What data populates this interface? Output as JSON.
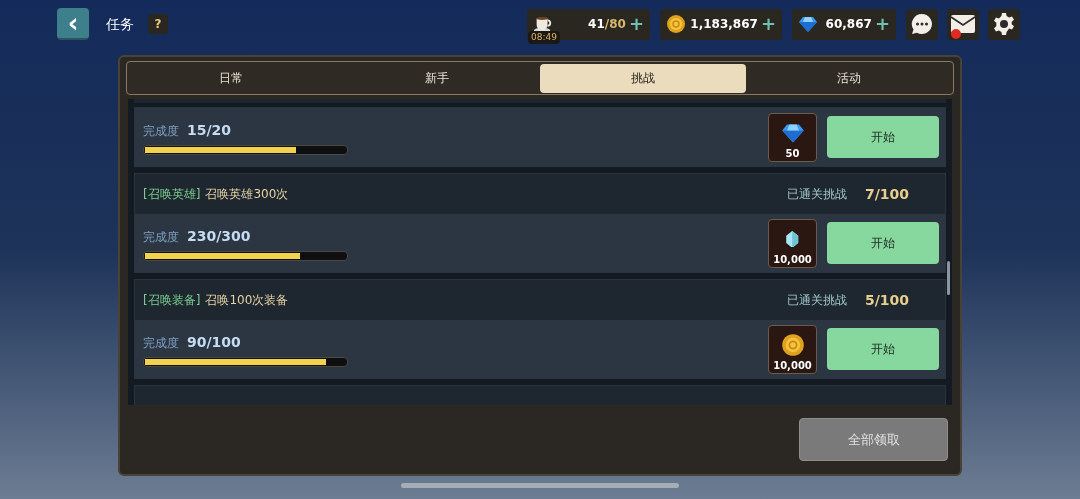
{
  "header": {
    "back": "‹",
    "title": "任务",
    "help": "?"
  },
  "resources": [
    {
      "kind": "stamina",
      "value": "41",
      "max": "/80",
      "timer": "08:49",
      "plus": "+"
    },
    {
      "kind": "coin",
      "value": "1,183,867",
      "plus": "+"
    },
    {
      "kind": "gem",
      "value": "60,867",
      "plus": "+"
    }
  ],
  "actions": [
    {
      "kind": "chat",
      "badge": false
    },
    {
      "kind": "mail",
      "badge": true
    },
    {
      "kind": "settings",
      "badge": false
    }
  ],
  "tabs": [
    {
      "label": "日常",
      "selected": false
    },
    {
      "label": "新手",
      "selected": false
    },
    {
      "label": "挑战",
      "selected": true
    },
    {
      "label": "活动",
      "selected": false
    }
  ],
  "tasks": [
    {
      "progress_label": "完成度",
      "progress": "15/20",
      "level": 0.75,
      "reward": {
        "kind": "gem",
        "amount": "50"
      },
      "button": "开始"
    },
    {
      "tag": "[召唤英雄]",
      "title": "召唤英雄300次",
      "cleared_label": "已通关挑战",
      "cleared": "7/100",
      "progress_label": "完成度",
      "progress": "230/300",
      "level": 0.77,
      "reward": {
        "kind": "crystal",
        "amount": "10,000"
      },
      "button": "开始"
    },
    {
      "tag": "[召唤装备]",
      "title": "召唤100次装备",
      "cleared_label": "已通关挑战",
      "cleared": "5/100",
      "progress_label": "完成度",
      "progress": "90/100",
      "level": 0.9,
      "reward": {
        "kind": "coin",
        "amount": "10,000"
      },
      "button": "开始"
    }
  ],
  "claim_all": {
    "label": "全部领取",
    "disabled": true
  }
}
